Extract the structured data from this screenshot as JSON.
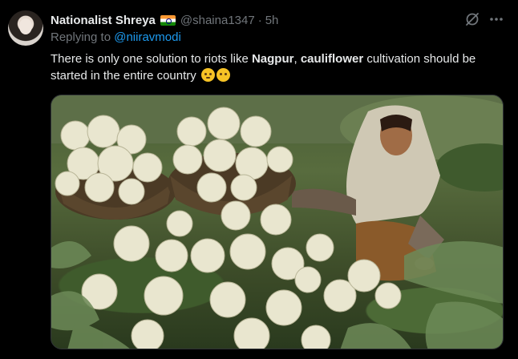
{
  "tweet": {
    "display_name": "Nationalist Shreya",
    "handle": "@shaina1347",
    "separator": "·",
    "time": "5h",
    "replying_prefix": "Replying to",
    "replying_to": "@niiravmodi",
    "text_parts": {
      "t1": "There is only one solution to riots like ",
      "b1": "Nagpur",
      "t2": ", ",
      "b2": "cauliflower",
      "t3": " cultivation should be started in the entire country"
    },
    "emojis": [
      "pleading-face-emoji",
      "no-mouth-face-emoji"
    ]
  },
  "icons": {
    "grok": "grok-icon",
    "more": "more-options-icon",
    "flag": "india-flag-icon"
  },
  "colors": {
    "background": "#000000",
    "text": "#e7e9ea",
    "muted": "#71767b",
    "link": "#1d9bf0"
  },
  "media": {
    "subject": "woman harvesting cauliflowers in a field with two baskets of cauliflower"
  }
}
